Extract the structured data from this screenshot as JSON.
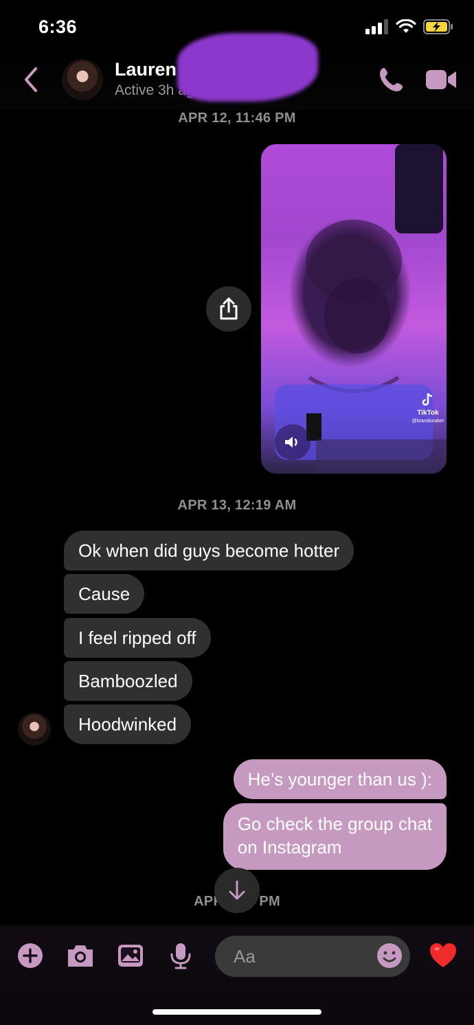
{
  "status_bar": {
    "time": "6:36",
    "battery_color": "#f4d53c"
  },
  "header": {
    "contact_name": "Lauren H",
    "contact_status": "Active 3h ago",
    "accent": "#c69ac0",
    "icons": [
      "chevron-left-icon",
      "phone-icon",
      "video-camera-icon"
    ]
  },
  "timestamps": {
    "first": "APR 12, 11:46 PM",
    "second": "APR 13, 12:19 AM",
    "third": "APR 1   8 PM"
  },
  "media": {
    "overlay_app": "TikTok",
    "overlay_user": "@brandonaber",
    "icons": [
      "share-icon",
      "speaker-icon"
    ]
  },
  "messages_in": [
    "Ok when did guys become hotter",
    "Cause",
    "I feel ripped off",
    "Bamboozled",
    "Hoodwinked"
  ],
  "messages_out": [
    "He’s younger than us ):",
    "Go check the group chat\non Instagram"
  ],
  "composer": {
    "placeholder": "Aa",
    "icons": [
      "plus-icon",
      "camera-icon",
      "image-icon",
      "microphone-icon",
      "emoji-icon",
      "heart-icon"
    ]
  }
}
